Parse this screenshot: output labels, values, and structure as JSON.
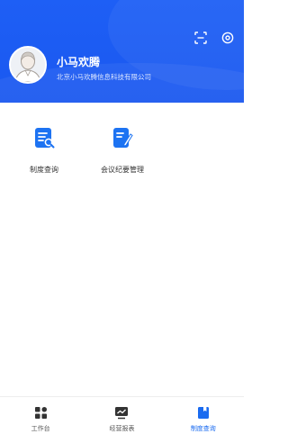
{
  "header": {
    "user_name": "小马欢腾",
    "company": "北京小马欢腾信息科技有限公司",
    "icons": [
      "scan-icon",
      "settings-icon"
    ]
  },
  "apps": [
    {
      "label": "制度查询",
      "icon": "document-search-icon"
    },
    {
      "label": "会议纪要管理",
      "icon": "edit-note-icon"
    }
  ],
  "tabbar": {
    "tabs": [
      {
        "label": "工作台",
        "icon": "grid-icon",
        "active": false
      },
      {
        "label": "经营报表",
        "icon": "chart-icon",
        "active": false
      },
      {
        "label": "制度查询",
        "icon": "book-icon",
        "active": true
      }
    ]
  },
  "colors": {
    "primary": "#1A58F0",
    "tab_inactive": "#555555",
    "tab_active": "#1A6BF0"
  }
}
